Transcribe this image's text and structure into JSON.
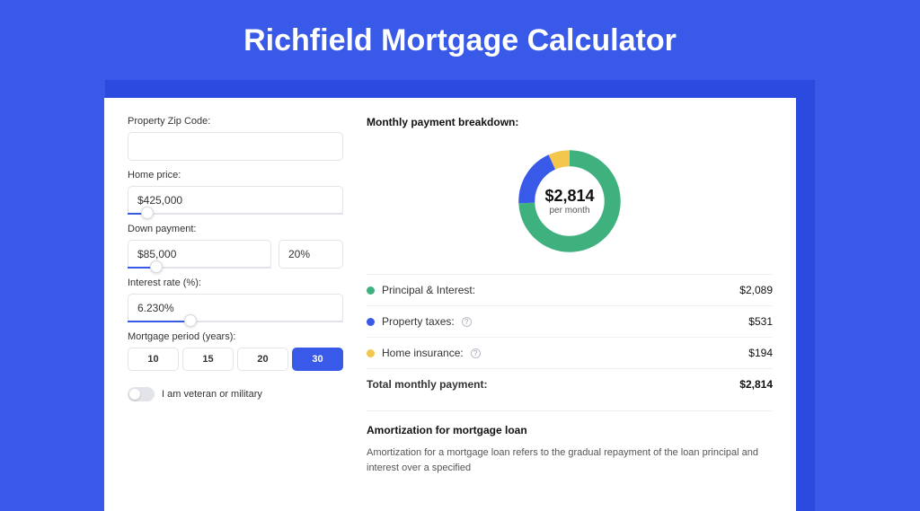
{
  "page_title": "Richfield Mortgage Calculator",
  "form": {
    "zip_label": "Property Zip Code:",
    "zip_value": "",
    "home_price_label": "Home price:",
    "home_price_value": "$425,000",
    "down_payment_label": "Down payment:",
    "down_payment_value": "$85,000",
    "down_payment_pct": "20%",
    "interest_label": "Interest rate (%):",
    "interest_value": "6.230%",
    "period_label": "Mortgage period (years):",
    "periods": [
      "10",
      "15",
      "20",
      "30"
    ],
    "period_selected": "30",
    "veteran_label": "I am veteran or military",
    "slider_positions": {
      "home_price_pct": 9,
      "down_payment_pct": 20,
      "interest_pct": 29
    }
  },
  "breakdown": {
    "heading": "Monthly payment breakdown:",
    "center_amount": "$2,814",
    "center_sub": "per month",
    "items": [
      {
        "label": "Principal & Interest:",
        "value": "$2,089",
        "color": "green"
      },
      {
        "label": "Property taxes:",
        "value": "$531",
        "color": "blue",
        "help": true
      },
      {
        "label": "Home insurance:",
        "value": "$194",
        "color": "yellow",
        "help": true
      }
    ],
    "total_label": "Total monthly payment:",
    "total_value": "$2,814"
  },
  "amortization": {
    "title": "Amortization for mortgage loan",
    "text": "Amortization for a mortgage loan refers to the gradual repayment of the loan principal and interest over a specified"
  },
  "chart_data": {
    "type": "pie",
    "title": "Monthly payment breakdown",
    "series": [
      {
        "name": "Principal & Interest",
        "value": 2089,
        "color": "#3fb17f"
      },
      {
        "name": "Property taxes",
        "value": 531,
        "color": "#3959e8"
      },
      {
        "name": "Home insurance",
        "value": 194,
        "color": "#f3c64d"
      }
    ],
    "total": 2814,
    "center_label": "$2,814 per month"
  }
}
